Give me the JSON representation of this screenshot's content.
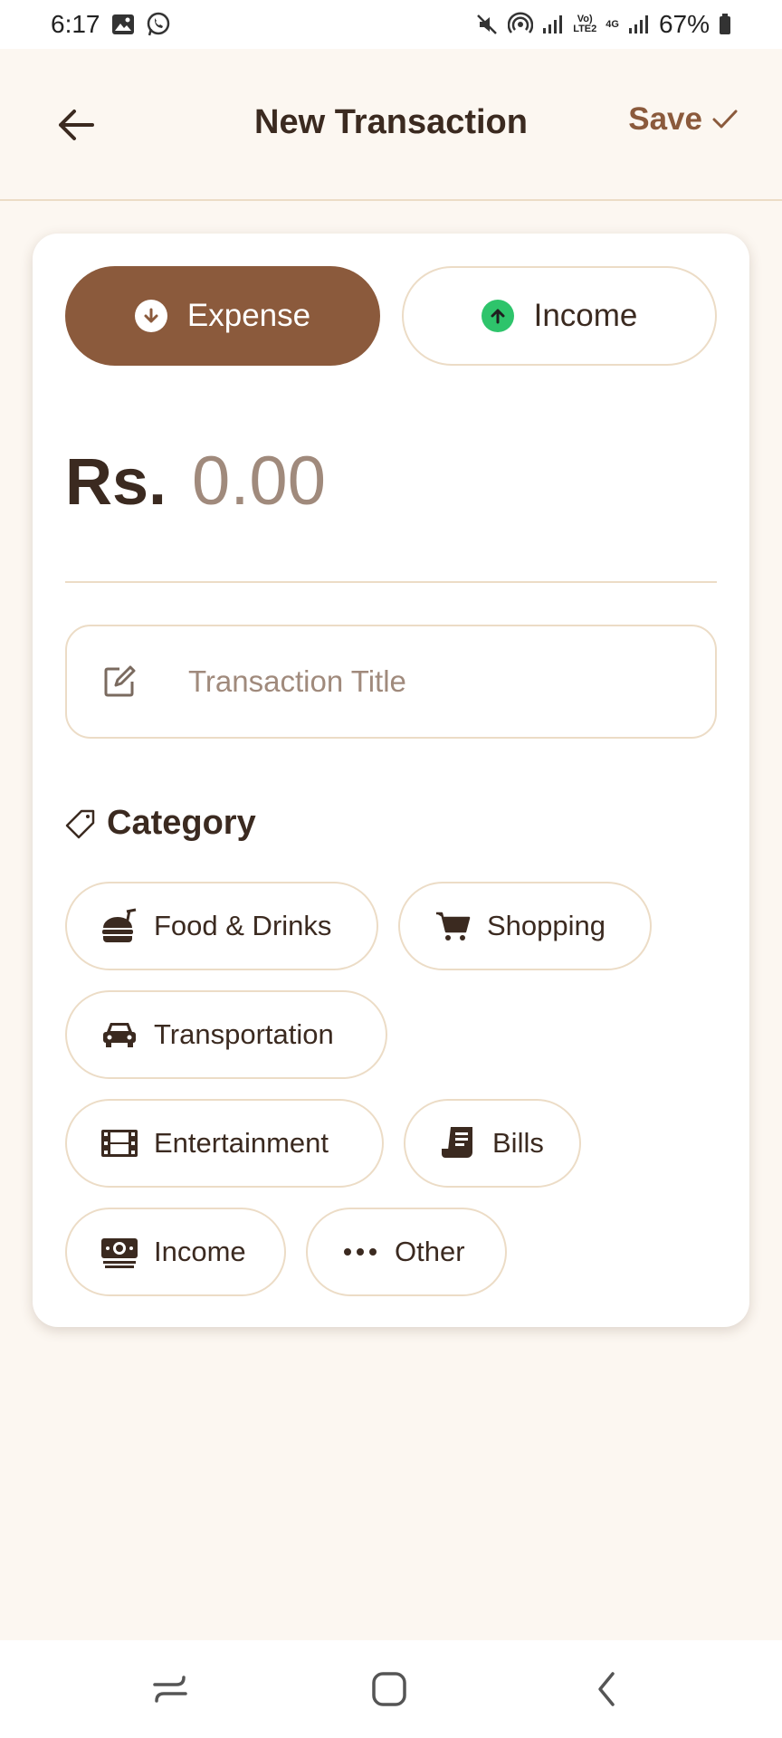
{
  "status_bar": {
    "time": "6:17",
    "battery": "67%",
    "volte": "Vo)\nLTE2",
    "network": "4G"
  },
  "header": {
    "title": "New Transaction",
    "save_label": "Save"
  },
  "transaction_type": {
    "expense_label": "Expense",
    "income_label": "Income",
    "selected": "Expense"
  },
  "amount": {
    "currency": "Rs.",
    "value": "0.00"
  },
  "title_field": {
    "placeholder": "Transaction Title"
  },
  "category": {
    "heading": "Category",
    "items": [
      {
        "label": "Food & Drinks",
        "icon": "food-icon"
      },
      {
        "label": "Shopping",
        "icon": "cart-icon"
      },
      {
        "label": "Transportation",
        "icon": "car-icon"
      },
      {
        "label": "Entertainment",
        "icon": "film-icon"
      },
      {
        "label": "Bills",
        "icon": "receipt-icon"
      },
      {
        "label": "Income",
        "icon": "money-icon"
      },
      {
        "label": "Other",
        "icon": "more-icon"
      }
    ]
  },
  "colors": {
    "accent": "#8b5a3c",
    "background": "#fcf7f1",
    "income_green": "#2ec46b",
    "border": "#ecdcc6"
  }
}
